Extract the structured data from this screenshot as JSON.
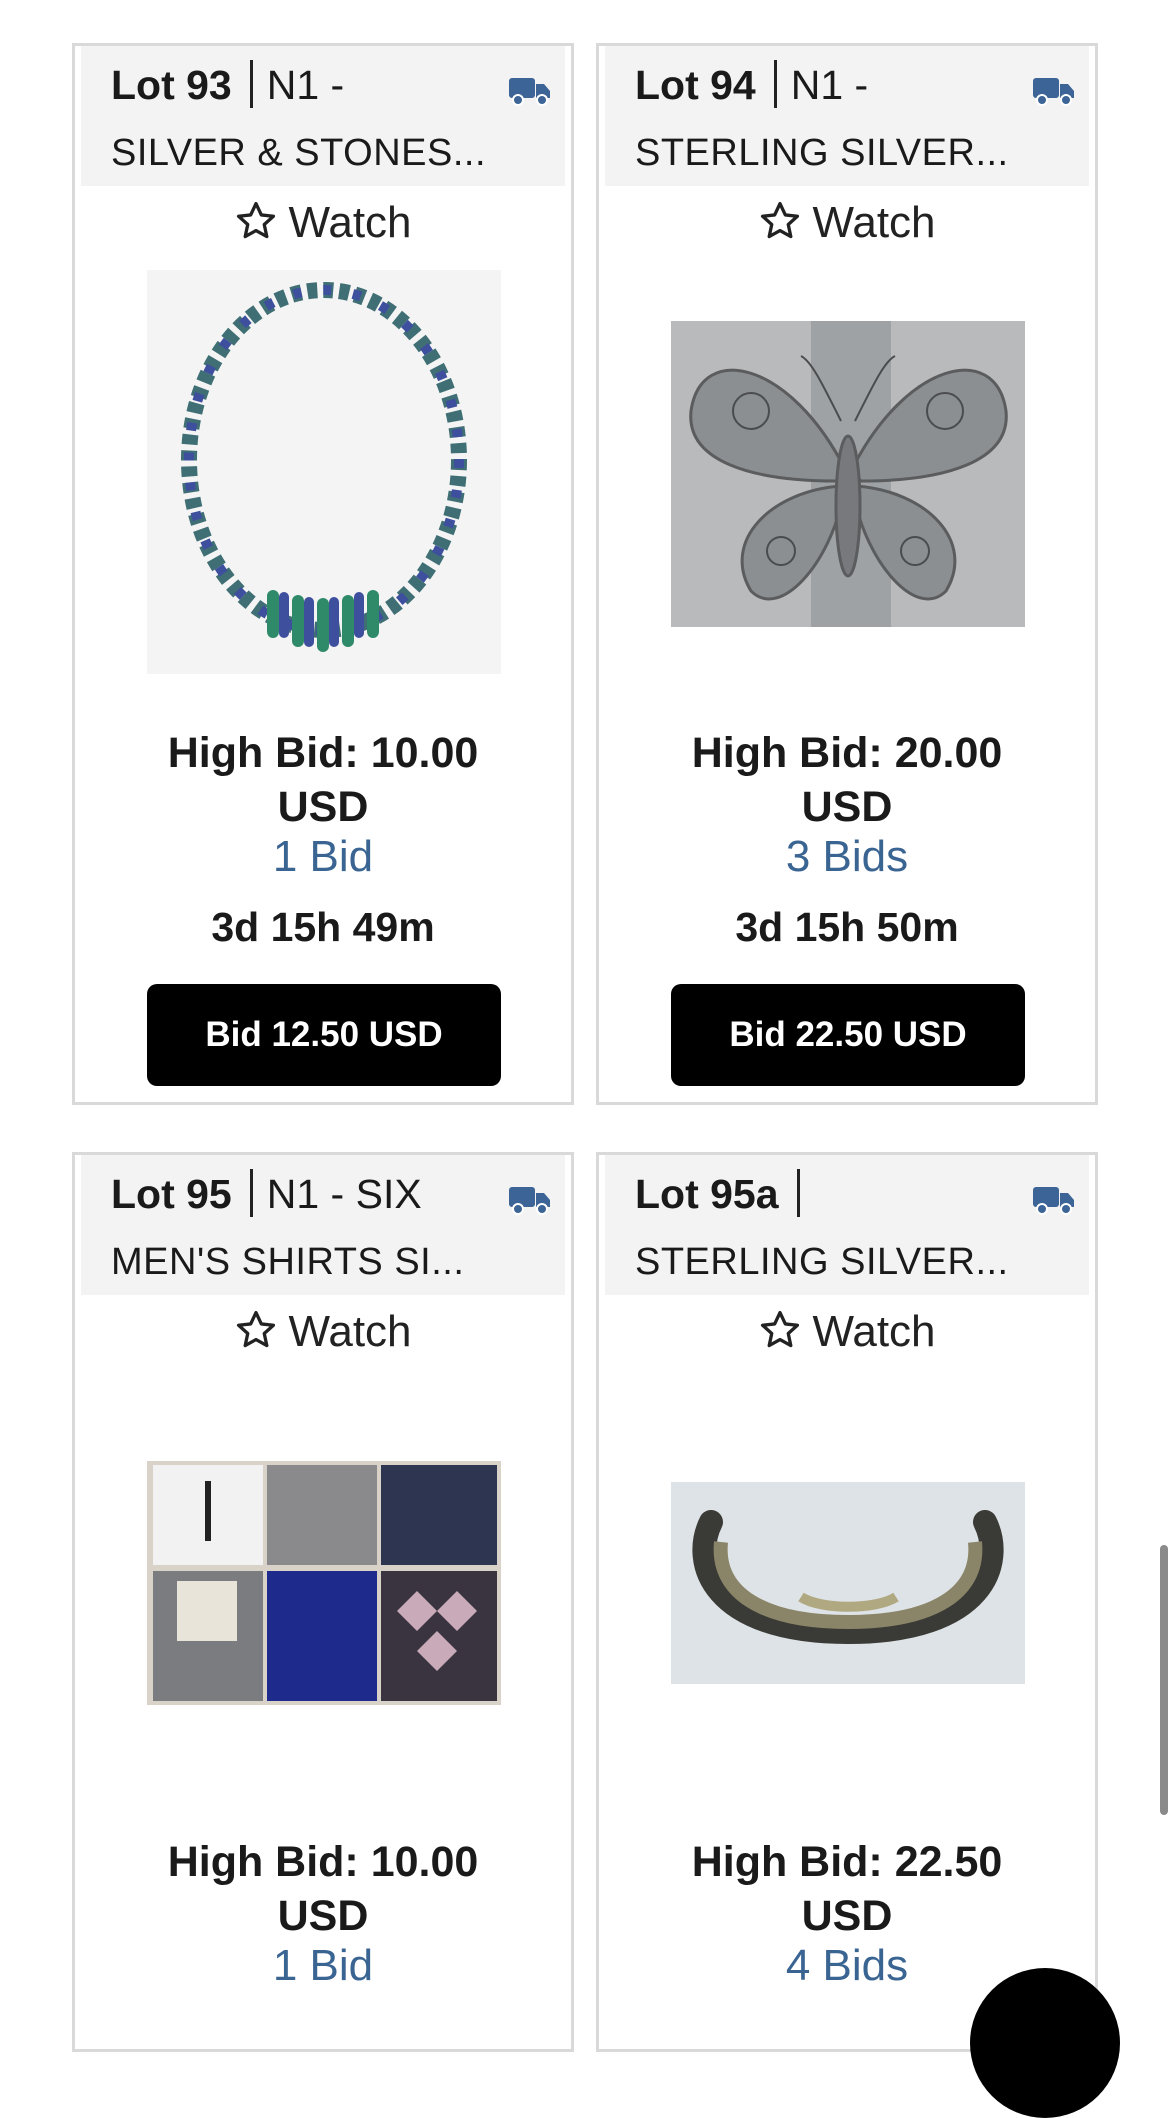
{
  "lots": [
    {
      "lot": "Lot 93",
      "sub": "N1 -",
      "title": "SILVER & STONES...",
      "watch": "Watch",
      "image_desc_icon": "necklace-image",
      "high_bid_1": "High Bid: 10.00",
      "high_bid_2": "USD",
      "bids": "1 Bid",
      "time": "3d 15h 49m",
      "button": "Bid 12.50 USD"
    },
    {
      "lot": "Lot 94",
      "sub": "N1 -",
      "title": "STERLING SILVER...",
      "watch": "Watch",
      "image_desc_icon": "butterfly-ring-image",
      "high_bid_1": "High Bid: 20.00",
      "high_bid_2": "USD",
      "bids": "3 Bids",
      "time": "3d 15h 50m",
      "button": "Bid 22.50 USD"
    },
    {
      "lot": "Lot 95",
      "sub": "N1 - SIX",
      "title": "MEN'S SHIRTS SI...",
      "watch": "Watch",
      "image_desc_icon": "shirts-image",
      "high_bid_1": "High Bid: 10.00",
      "high_bid_2": "USD",
      "bids": "1 Bid"
    },
    {
      "lot": "Lot 95a",
      "sub": "",
      "title": "STERLING SILVER...",
      "watch": "Watch",
      "image_desc_icon": "bracelet-image",
      "high_bid_1": "High Bid: 22.50",
      "high_bid_2": "USD",
      "bids": "4 Bids"
    }
  ],
  "colors": {
    "link": "#3a6492",
    "truck": "#3c6496",
    "button_bg": "#000000"
  },
  "icons": {
    "shipping": "truck-icon",
    "watch": "star-outline-icon"
  }
}
